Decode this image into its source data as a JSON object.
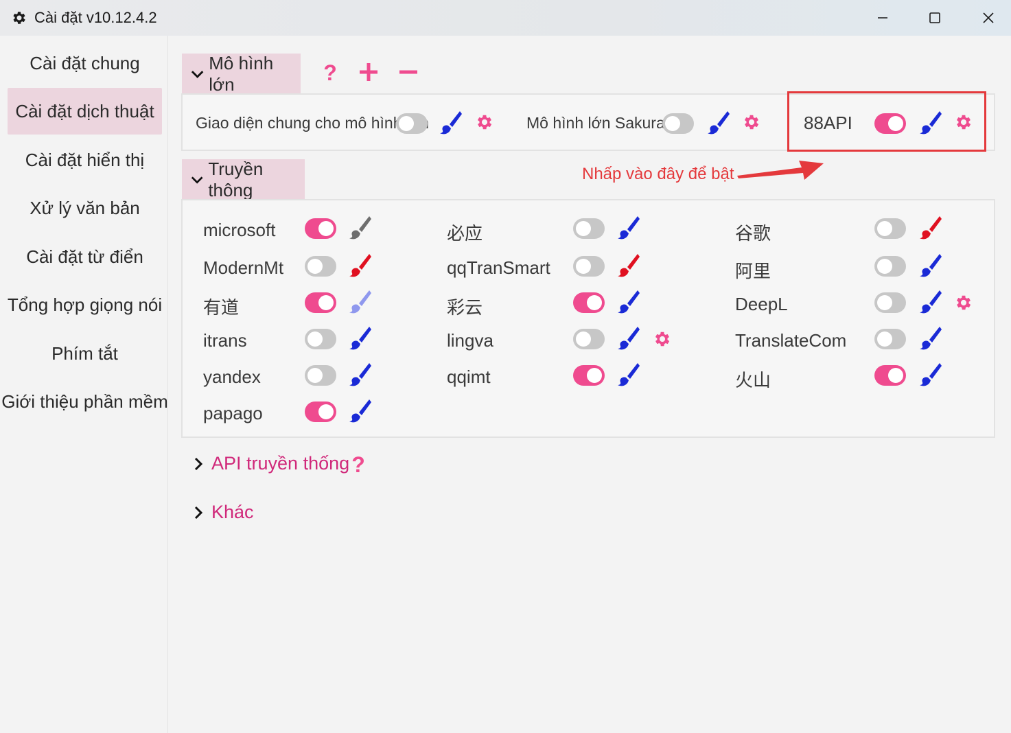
{
  "window": {
    "title": "Cài đặt v10.12.4.2",
    "icon": "gear-icon",
    "controls": [
      "minimize-icon",
      "maximize-icon",
      "close-icon"
    ]
  },
  "sidebar": {
    "items": [
      {
        "label": "Cài đặt chung",
        "active": false
      },
      {
        "label": "Cài đặt dịch thuật",
        "active": true
      },
      {
        "label": "Cài đặt hiển thị",
        "active": false
      },
      {
        "label": "Xử lý văn bản",
        "active": false
      },
      {
        "label": "Cài đặt từ điển",
        "active": false
      },
      {
        "label": "Tổng hợp giọng nói",
        "active": false
      },
      {
        "label": "Phím tắt",
        "active": false
      },
      {
        "label": "Giới thiệu phần mềm",
        "active": false
      }
    ]
  },
  "llm_section": {
    "title": "Mô hình lớn",
    "actions": [
      "help-icon",
      "add-icon",
      "remove-icon"
    ],
    "items": [
      {
        "label": "Giao diện chung cho mô hình lớn",
        "enabled": false,
        "brush_color": "#1a2ad6",
        "has_settings": true
      },
      {
        "label": "Mô hình lớn Sakura",
        "enabled": false,
        "brush_color": "#1a2ad6",
        "has_settings": true
      },
      {
        "label": "88API",
        "enabled": true,
        "brush_color": "#1a2ad6",
        "has_settings": true
      }
    ]
  },
  "annotation": {
    "text": "Nhấp vào đây để bật",
    "color": "#e4393c"
  },
  "traditional_section": {
    "title": "Truyền thông",
    "columns": [
      [
        {
          "label": "microsoft",
          "enabled": true,
          "brush_color": "#6e6e6e",
          "has_settings": false
        },
        {
          "label": "ModernMt",
          "enabled": false,
          "brush_color": "#e01020",
          "has_settings": false
        },
        {
          "label": "有道",
          "enabled": true,
          "brush_color": "#8f98ee",
          "has_settings": false
        },
        {
          "label": "itrans",
          "enabled": false,
          "brush_color": "#1a2ad6",
          "has_settings": false
        },
        {
          "label": "yandex",
          "enabled": false,
          "brush_color": "#1a2ad6",
          "has_settings": false
        },
        {
          "label": "papago",
          "enabled": true,
          "brush_color": "#1a2ad6",
          "has_settings": false
        }
      ],
      [
        {
          "label": "必应",
          "enabled": false,
          "brush_color": "#1a2ad6",
          "has_settings": false
        },
        {
          "label": "qqTranSmart",
          "enabled": false,
          "brush_color": "#e01020",
          "has_settings": false
        },
        {
          "label": "彩云",
          "enabled": true,
          "brush_color": "#1a2ad6",
          "has_settings": false
        },
        {
          "label": "lingva",
          "enabled": false,
          "brush_color": "#1a2ad6",
          "has_settings": true
        },
        {
          "label": "qqimt",
          "enabled": true,
          "brush_color": "#1a2ad6",
          "has_settings": false
        }
      ],
      [
        {
          "label": "谷歌",
          "enabled": false,
          "brush_color": "#e01020",
          "has_settings": false
        },
        {
          "label": "阿里",
          "enabled": false,
          "brush_color": "#1a2ad6",
          "has_settings": false
        },
        {
          "label": "DeepL",
          "enabled": false,
          "brush_color": "#1a2ad6",
          "has_settings": true
        },
        {
          "label": "TranslateCom",
          "enabled": false,
          "brush_color": "#1a2ad6",
          "has_settings": false
        },
        {
          "label": "火山",
          "enabled": true,
          "brush_color": "#1a2ad6",
          "has_settings": false
        }
      ]
    ]
  },
  "collapsed_sections": [
    {
      "title": "API truyền thống",
      "has_help": true
    },
    {
      "title": "Khác",
      "has_help": false
    }
  ],
  "colors": {
    "accent": "#ef4b8f",
    "accent_text": "#d0287a",
    "section_header_bg": "#ecd5de",
    "toggle_off": "#c7c7c7"
  }
}
